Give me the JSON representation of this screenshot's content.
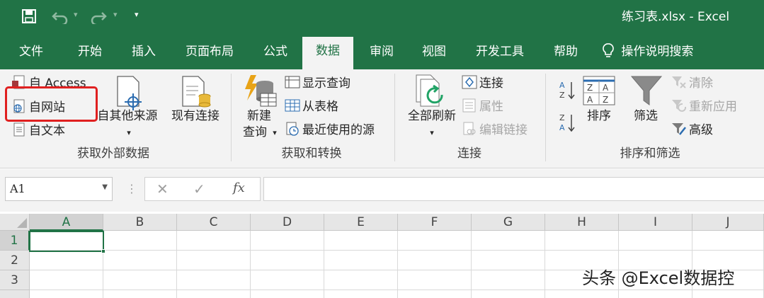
{
  "title": {
    "document": "练习表.xlsx  -  Excel"
  },
  "quick_access": {
    "icons": [
      "save-icon",
      "undo-icon",
      "redo-icon",
      "customize-icon"
    ]
  },
  "tabs": [
    {
      "label": "文件",
      "active": false
    },
    {
      "label": "开始",
      "active": false
    },
    {
      "label": "插入",
      "active": false
    },
    {
      "label": "页面布局",
      "active": false
    },
    {
      "label": "公式",
      "active": false
    },
    {
      "label": "数据",
      "active": true
    },
    {
      "label": "审阅",
      "active": false
    },
    {
      "label": "视图",
      "active": false
    },
    {
      "label": "开发工具",
      "active": false
    },
    {
      "label": "帮助",
      "active": false
    }
  ],
  "tell_me": {
    "label": "操作说明搜索",
    "icon": "lightbulb-icon"
  },
  "ribbon": {
    "external_data": {
      "group_label": "获取外部数据",
      "from_access": "自 Access",
      "from_web": "自网站",
      "from_text": "自文本",
      "from_other": "自其他来源",
      "existing_connections": "现有连接"
    },
    "get_transform": {
      "group_label": "获取和转换",
      "new_query_line1": "新建",
      "new_query_line2": "查询",
      "show_queries": "显示查询",
      "from_table": "从表格",
      "recent_sources": "最近使用的源"
    },
    "connections": {
      "group_label": "连接",
      "refresh_all": "全部刷新",
      "connections": "连接",
      "properties": "属性",
      "edit_links": "编辑链接"
    },
    "sort_filter": {
      "group_label": "排序和筛选",
      "sort": "排序",
      "filter": "筛选",
      "clear": "清除",
      "reapply": "重新应用",
      "advanced": "高级"
    }
  },
  "formula_bar": {
    "name_box": "A1",
    "cancel_symbol": "✕",
    "enter_symbol": "✓",
    "fx_symbol": "fx",
    "formula": ""
  },
  "grid": {
    "columns": [
      "A",
      "B",
      "C",
      "D",
      "E",
      "F",
      "G",
      "H",
      "I",
      "J"
    ],
    "rows": [
      "1",
      "2",
      "3"
    ],
    "active_cell": "A1"
  },
  "colors": {
    "excel_green": "#217346",
    "highlight_red": "#e02020"
  },
  "watermark": "头条 @Excel数据控"
}
